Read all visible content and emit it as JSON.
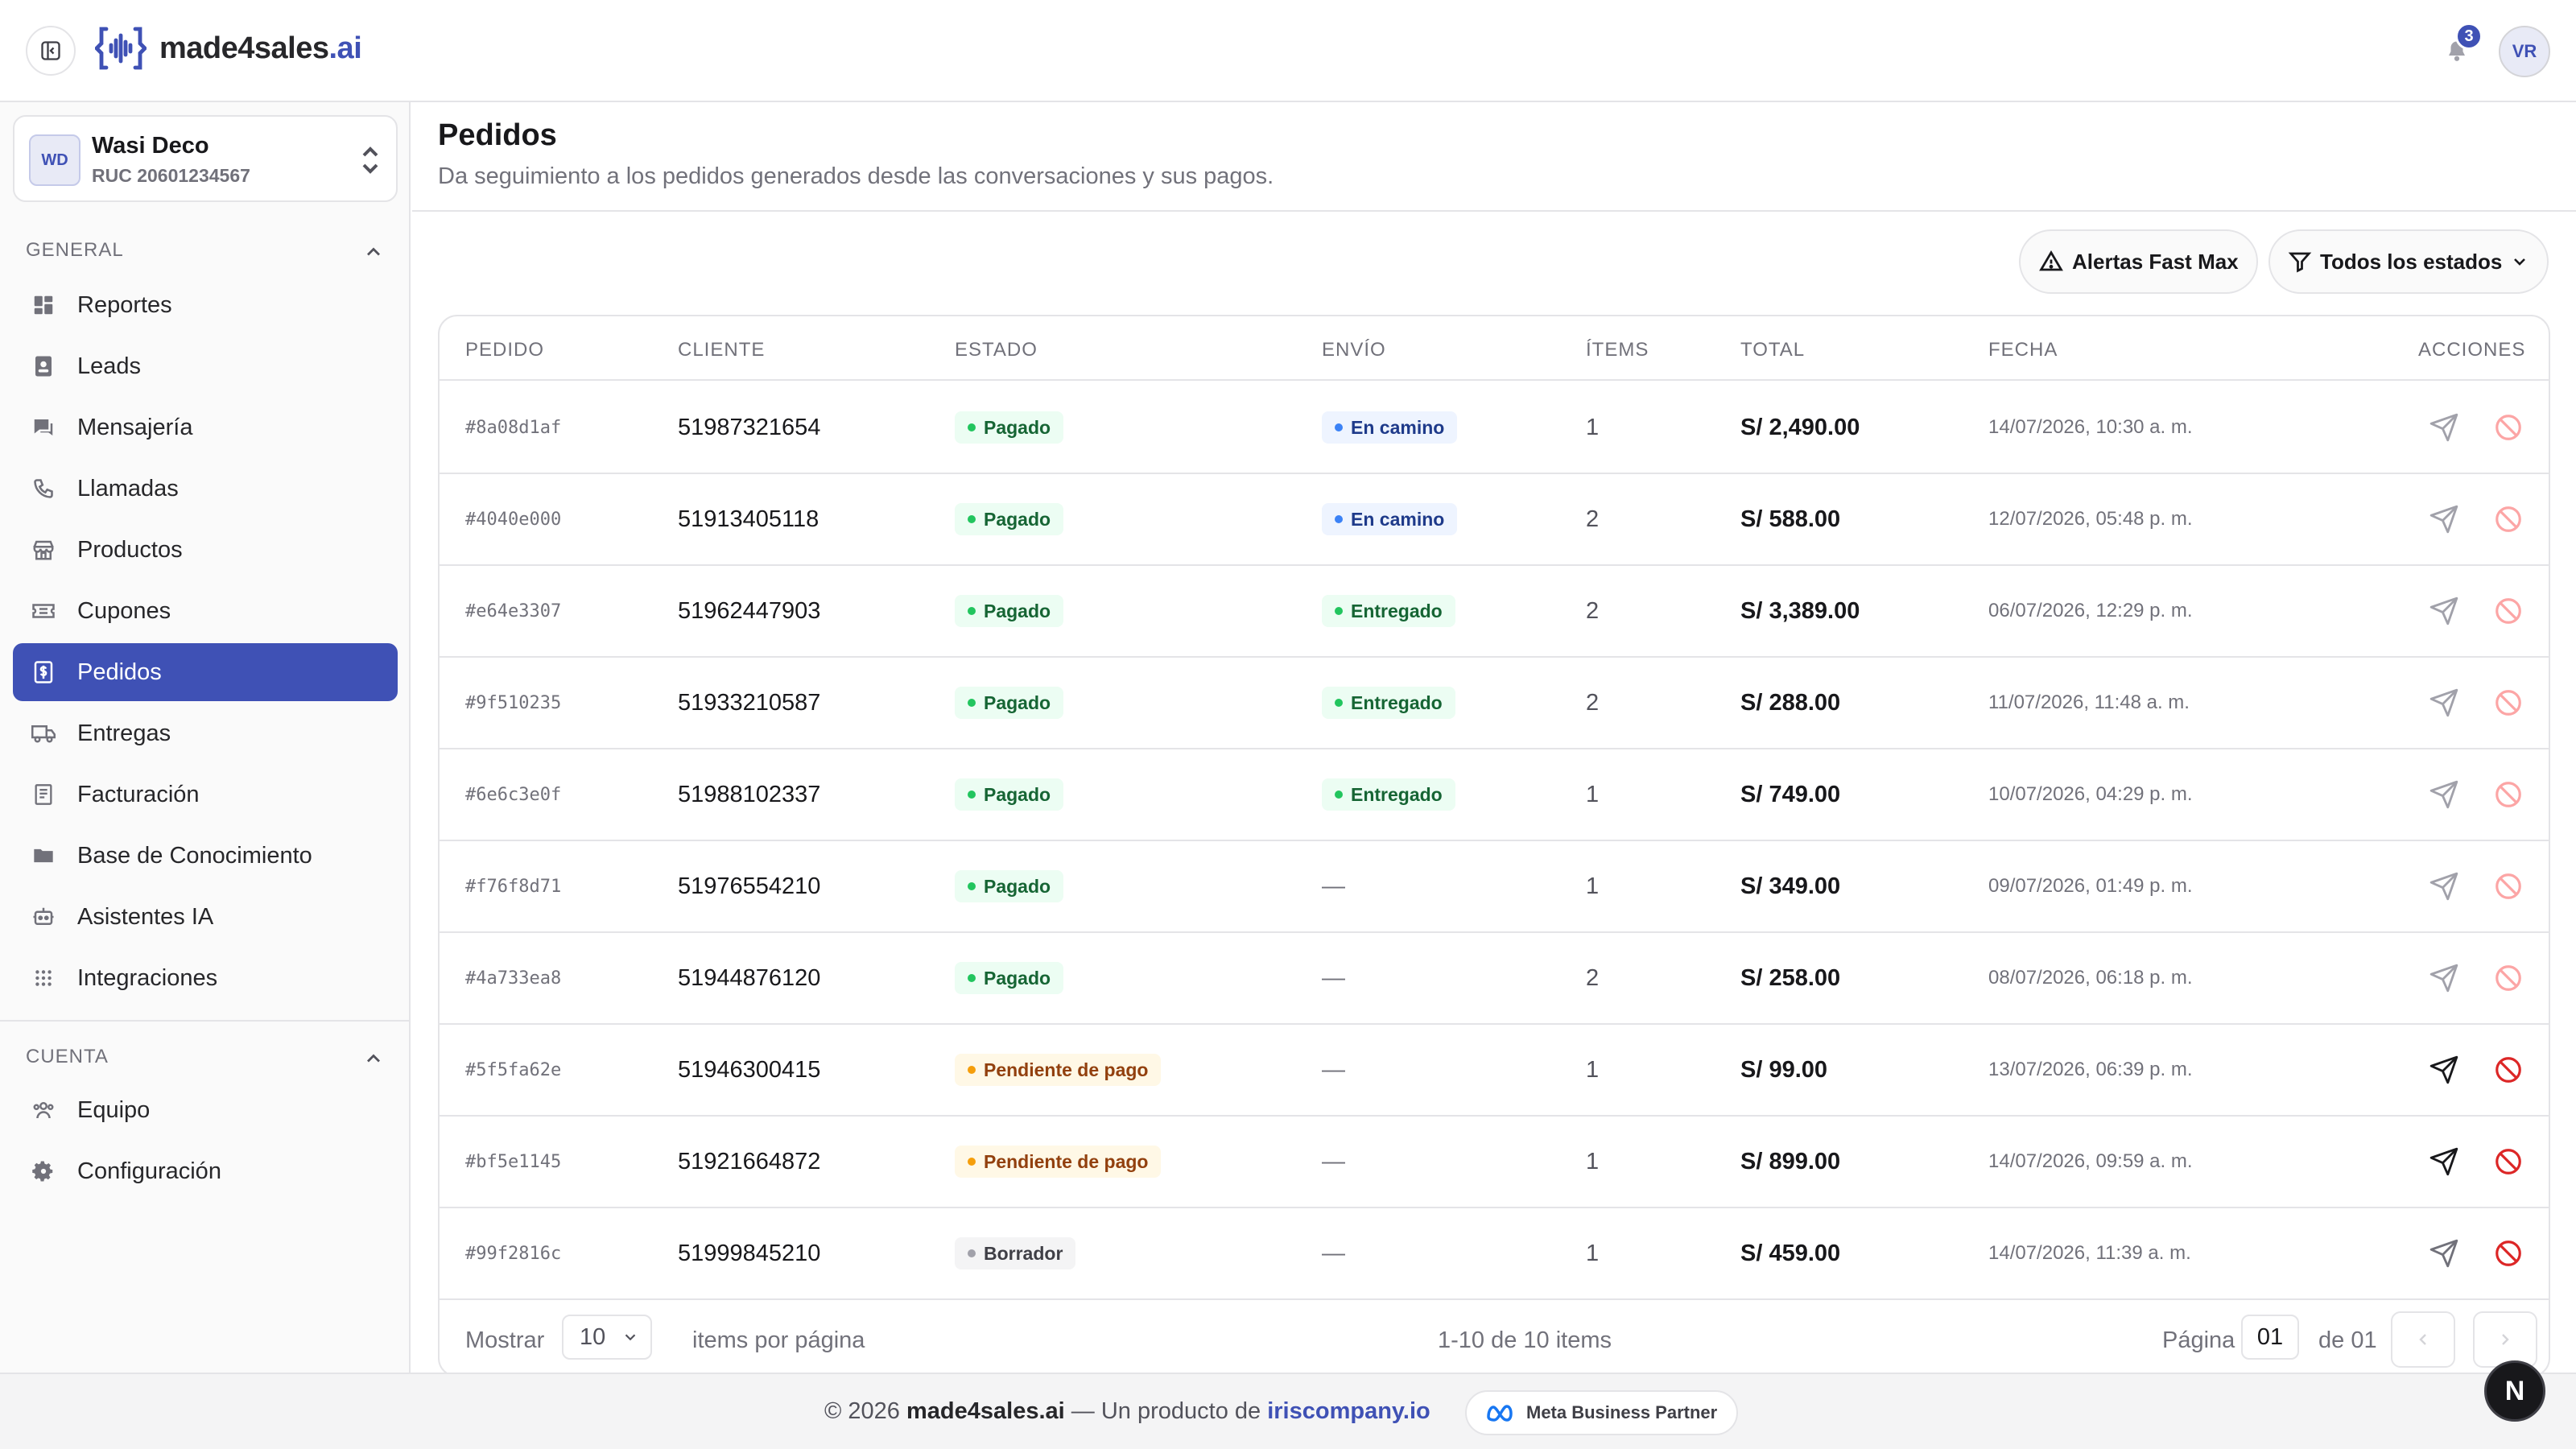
{
  "app": {
    "logo_main": "made4sales",
    "logo_suffix": ".ai",
    "notifications_count": "3",
    "user_initials": "VR"
  },
  "company": {
    "initials": "WD",
    "name": "Wasi Deco",
    "ruc": "RUC 20601234567"
  },
  "sidebar": {
    "general_label": "GENERAL",
    "account_label": "CUENTA",
    "general_items": [
      {
        "label": "Reportes",
        "icon": "dashboard-icon"
      },
      {
        "label": "Leads",
        "icon": "contacts-icon"
      },
      {
        "label": "Mensajería",
        "icon": "chat-icon"
      },
      {
        "label": "Llamadas",
        "icon": "phone-icon"
      },
      {
        "label": "Productos",
        "icon": "store-icon"
      },
      {
        "label": "Cupones",
        "icon": "ticket-icon"
      },
      {
        "label": "Pedidos",
        "icon": "receipt-dollar-icon",
        "active": true
      },
      {
        "label": "Entregas",
        "icon": "truck-icon"
      },
      {
        "label": "Facturación",
        "icon": "invoice-icon"
      },
      {
        "label": "Base de Conocimiento",
        "icon": "folder-icon"
      },
      {
        "label": "Asistentes IA",
        "icon": "robot-icon"
      },
      {
        "label": "Integraciones",
        "icon": "grid-icon"
      }
    ],
    "account_items": [
      {
        "label": "Equipo",
        "icon": "team-icon"
      },
      {
        "label": "Configuración",
        "icon": "gear-icon"
      }
    ]
  },
  "page": {
    "title": "Pedidos",
    "subtitle": "Da seguimiento a los pedidos generados desde las conversaciones y sus pagos."
  },
  "toolbar": {
    "alerts_label": "Alertas Fast Max",
    "status_filter_label": "Todos los estados"
  },
  "table": {
    "headers": {
      "pedido": "PEDIDO",
      "cliente": "CLIENTE",
      "estado": "ESTADO",
      "envio": "ENVÍO",
      "items": "ÍTEMS",
      "total": "TOTAL",
      "fecha": "FECHA",
      "acciones": "ACCIONES"
    },
    "rows": [
      {
        "id": "#8a08d1af",
        "client": "51987321654",
        "status": "Pagado",
        "status_tone": "green",
        "shipping": "En camino",
        "shipping_tone": "blue",
        "items": "1",
        "total": "S/ 2,490.00",
        "date": "14/07/2026, 10:30 a. m.",
        "actions_enabled": false
      },
      {
        "id": "#4040e000",
        "client": "51913405118",
        "status": "Pagado",
        "status_tone": "green",
        "shipping": "En camino",
        "shipping_tone": "blue",
        "items": "2",
        "total": "S/ 588.00",
        "date": "12/07/2026, 05:48 p. m.",
        "actions_enabled": false
      },
      {
        "id": "#e64e3307",
        "client": "51962447903",
        "status": "Pagado",
        "status_tone": "green",
        "shipping": "Entregado",
        "shipping_tone": "green",
        "items": "2",
        "total": "S/ 3,389.00",
        "date": "06/07/2026, 12:29 p. m.",
        "actions_enabled": false
      },
      {
        "id": "#9f510235",
        "client": "51933210587",
        "status": "Pagado",
        "status_tone": "green",
        "shipping": "Entregado",
        "shipping_tone": "green",
        "items": "2",
        "total": "S/ 288.00",
        "date": "11/07/2026, 11:48 a. m.",
        "actions_enabled": false
      },
      {
        "id": "#6e6c3e0f",
        "client": "51988102337",
        "status": "Pagado",
        "status_tone": "green",
        "shipping": "Entregado",
        "shipping_tone": "green",
        "items": "1",
        "total": "S/ 749.00",
        "date": "10/07/2026, 04:29 p. m.",
        "actions_enabled": false
      },
      {
        "id": "#f76f8d71",
        "client": "51976554210",
        "status": "Pagado",
        "status_tone": "green",
        "shipping": "—",
        "shipping_tone": "none",
        "items": "1",
        "total": "S/ 349.00",
        "date": "09/07/2026, 01:49 p. m.",
        "actions_enabled": false
      },
      {
        "id": "#4a733ea8",
        "client": "51944876120",
        "status": "Pagado",
        "status_tone": "green",
        "shipping": "—",
        "shipping_tone": "none",
        "items": "2",
        "total": "S/ 258.00",
        "date": "08/07/2026, 06:18 p. m.",
        "actions_enabled": false
      },
      {
        "id": "#5f5fa62e",
        "client": "51946300415",
        "status": "Pendiente de pago",
        "status_tone": "amber",
        "shipping": "—",
        "shipping_tone": "none",
        "items": "1",
        "total": "S/ 99.00",
        "date": "13/07/2026, 06:39 p. m.",
        "actions_enabled": true
      },
      {
        "id": "#bf5e1145",
        "client": "51921664872",
        "status": "Pendiente de pago",
        "status_tone": "amber",
        "shipping": "—",
        "shipping_tone": "none",
        "items": "1",
        "total": "S/ 899.00",
        "date": "14/07/2026, 09:59 a. m.",
        "actions_enabled": true
      },
      {
        "id": "#99f2816c",
        "client": "51999845210",
        "status": "Borrador",
        "status_tone": "gray",
        "shipping": "—",
        "shipping_tone": "none",
        "items": "1",
        "total": "S/ 459.00",
        "date": "14/07/2026, 11:39 a. m.",
        "actions_enabled": "partial"
      }
    ]
  },
  "pagination": {
    "show_label": "Mostrar",
    "per_page_value": "10",
    "per_page_suffix": "items por página",
    "range_label": "1-10 de 10 items",
    "page_label": "Página",
    "current_page": "01",
    "total_pages_label": "de 01"
  },
  "footer": {
    "copyright": "© 2026",
    "brand": "made4sales.ai",
    "dash_text": "— Un producto de",
    "company_link": "iriscompany.io",
    "partner_badge": "Meta Business Partner"
  },
  "fab_label": "N",
  "colors": {
    "accent": "#3f51b5",
    "paid_green": "#22c55e",
    "pending_amber": "#f59e0b",
    "transit_blue": "#3b82f6",
    "cancel_red": "#dc2626"
  }
}
